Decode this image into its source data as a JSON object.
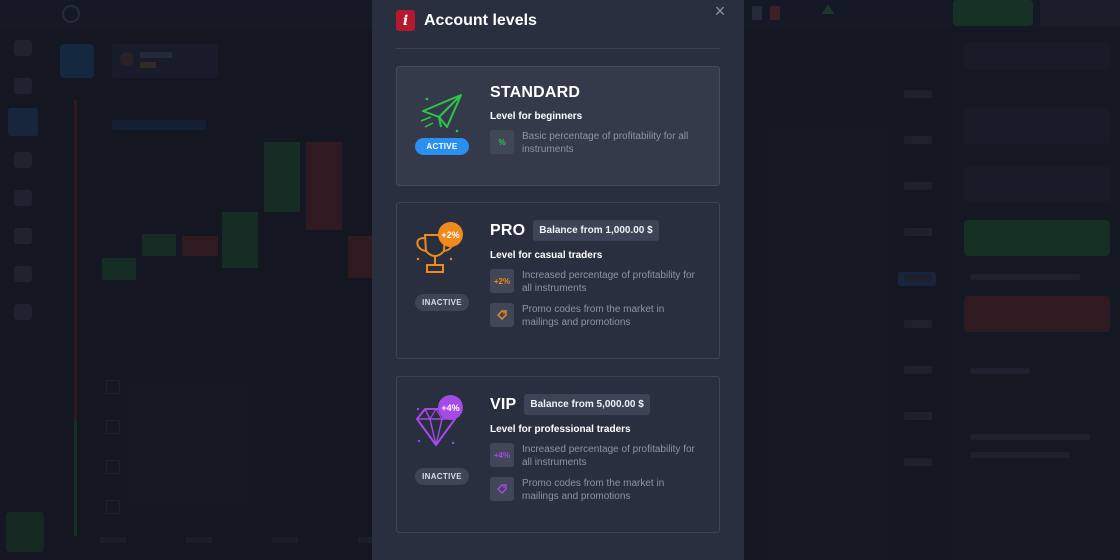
{
  "modal": {
    "title": "Account levels",
    "info_icon": "i",
    "close_icon": "×"
  },
  "levels": [
    {
      "name": "STANDARD",
      "description": "Level for beginners",
      "status": "ACTIVE",
      "icon": "paper-plane-icon",
      "color": "#2cc64a",
      "features": [
        {
          "icon_text": "%",
          "text": "Basic percentage of profitability for all instruments"
        }
      ]
    },
    {
      "name": "PRO",
      "balance_badge": "Balance from 1,000.00 $",
      "description": "Level for casual traders",
      "status": "INACTIVE",
      "icon": "trophy-icon",
      "bubble": "+2%",
      "color": "#f08a1c",
      "features": [
        {
          "icon_text": "+2%",
          "text": "Increased percentage of profitability for all instruments"
        },
        {
          "icon_text": "",
          "text": "Promo codes from the market in mailings and promotions"
        }
      ]
    },
    {
      "name": "VIP",
      "balance_badge": "Balance from 5,000.00 $",
      "description": "Level for professional traders",
      "status": "INACTIVE",
      "icon": "diamond-icon",
      "bubble": "+4%",
      "color": "#a44be6",
      "features": [
        {
          "icon_text": "+4%",
          "text": "Increased percentage of profitability for all instruments"
        },
        {
          "icon_text": "",
          "text": "Promo codes from the market in mailings and promotions"
        }
      ]
    }
  ],
  "colors": {
    "active_badge": "#2a8ff0",
    "info_icon_bg": "#b5192e",
    "modal_bg": "#2a2f3f"
  }
}
